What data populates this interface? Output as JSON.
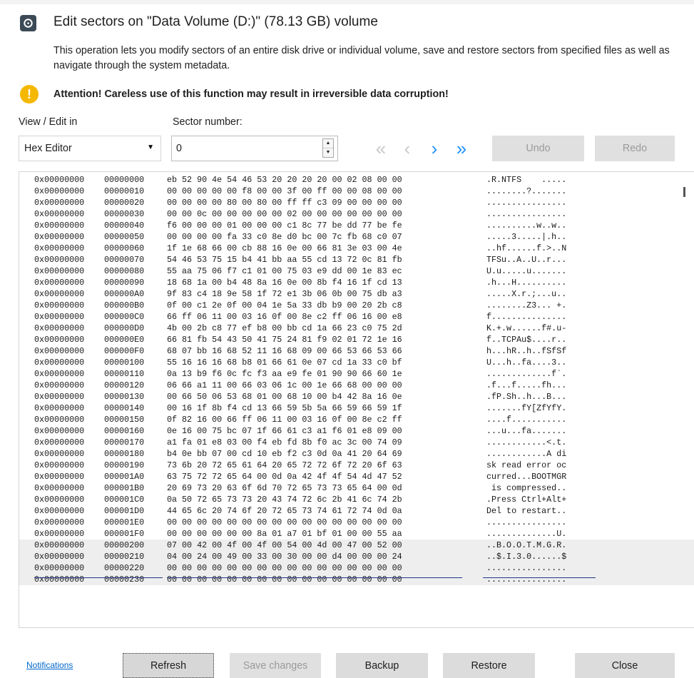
{
  "dialog": {
    "title": "Edit sectors on \"Data Volume (D:)\" (78.13 GB) volume",
    "description": "This operation lets you modify sectors of an entire disk drive or individual volume, save and restore sectors from specified files as well as navigate through the system metadata.",
    "warning": "Attention! Careless use of this function may result in irreversible data corruption!",
    "warning_icon": "exclamation-icon",
    "app_icon": "disk-icon"
  },
  "toolbar": {
    "view_label": "View / Edit in",
    "view_value": "Hex Editor",
    "sector_label": "Sector number:",
    "sector_value": "0",
    "first_glyph": "«",
    "prev_glyph": "‹",
    "next_glyph": "›",
    "last_glyph": "»",
    "undo_label": "Undo",
    "redo_label": "Redo"
  },
  "hex": {
    "rows": [
      {
        "addr": "0x00000000",
        "off": "00000000",
        "hex": "eb 52 90 4e 54 46 53 20 20 20 20 00 02 08 00 00",
        "ascii": ".R.NTFS    ....."
      },
      {
        "addr": "0x00000000",
        "off": "00000010",
        "hex": "00 00 00 00 00 f8 00 00 3f 00 ff 00 00 08 00 00",
        "ascii": "........?......."
      },
      {
        "addr": "0x00000000",
        "off": "00000020",
        "hex": "00 00 00 00 80 00 80 00 ff ff c3 09 00 00 00 00",
        "ascii": "................"
      },
      {
        "addr": "0x00000000",
        "off": "00000030",
        "hex": "00 00 0c 00 00 00 00 00 02 00 00 00 00 00 00 00",
        "ascii": "................"
      },
      {
        "addr": "0x00000000",
        "off": "00000040",
        "hex": "f6 00 00 00 01 00 00 00 c1 8c 77 be dd 77 be fe",
        "ascii": "..........w..w.."
      },
      {
        "addr": "0x00000000",
        "off": "00000050",
        "hex": "00 00 00 00 fa 33 c0 8e d0 bc 00 7c fb 68 c0 07",
        "ascii": ".....3.....|.h.."
      },
      {
        "addr": "0x00000000",
        "off": "00000060",
        "hex": "1f 1e 68 66 00 cb 88 16 0e 00 66 81 3e 03 00 4e",
        "ascii": "..hf......f.>..N"
      },
      {
        "addr": "0x00000000",
        "off": "00000070",
        "hex": "54 46 53 75 15 b4 41 bb aa 55 cd 13 72 0c 81 fb",
        "ascii": "TFSu..A..U..r..."
      },
      {
        "addr": "0x00000000",
        "off": "00000080",
        "hex": "55 aa 75 06 f7 c1 01 00 75 03 e9 dd 00 1e 83 ec",
        "ascii": "U.u.....u......."
      },
      {
        "addr": "0x00000000",
        "off": "00000090",
        "hex": "18 68 1a 00 b4 48 8a 16 0e 00 8b f4 16 1f cd 13",
        "ascii": ".h...H.........."
      },
      {
        "addr": "0x00000000",
        "off": "000000A0",
        "hex": "9f 83 c4 18 9e 58 1f 72 e1 3b 06 0b 00 75 db a3",
        "ascii": ".....X.r.;...u.."
      },
      {
        "addr": "0x00000000",
        "off": "000000B0",
        "hex": "0f 00 c1 2e 0f 00 04 1e 5a 33 db b9 00 20 2b c8",
        "ascii": "........Z3... +."
      },
      {
        "addr": "0x00000000",
        "off": "000000C0",
        "hex": "66 ff 06 11 00 03 16 0f 00 8e c2 ff 06 16 00 e8",
        "ascii": "f..............."
      },
      {
        "addr": "0x00000000",
        "off": "000000D0",
        "hex": "4b 00 2b c8 77 ef b8 00 bb cd 1a 66 23 c0 75 2d",
        "ascii": "K.+.w......f#.u-"
      },
      {
        "addr": "0x00000000",
        "off": "000000E0",
        "hex": "66 81 fb 54 43 50 41 75 24 81 f9 02 01 72 1e 16",
        "ascii": "f..TCPAu$....r.."
      },
      {
        "addr": "0x00000000",
        "off": "000000F0",
        "hex": "68 07 bb 16 68 52 11 16 68 09 00 66 53 66 53 66",
        "ascii": "h...hR..h..fSfSf"
      },
      {
        "addr": "0x00000000",
        "off": "00000100",
        "hex": "55 16 16 16 68 b8 01 66 61 0e 07 cd 1a 33 c0 bf",
        "ascii": "U...h..fa....3.."
      },
      {
        "addr": "0x00000000",
        "off": "00000110",
        "hex": "0a 13 b9 f6 0c fc f3 aa e9 fe 01 90 90 66 60 1e",
        "ascii": ".............f`."
      },
      {
        "addr": "0x00000000",
        "off": "00000120",
        "hex": "06 66 a1 11 00 66 03 06 1c 00 1e 66 68 00 00 00",
        "ascii": ".f...f.....fh..."
      },
      {
        "addr": "0x00000000",
        "off": "00000130",
        "hex": "00 66 50 06 53 68 01 00 68 10 00 b4 42 8a 16 0e",
        "ascii": ".fP.Sh..h...B..."
      },
      {
        "addr": "0x00000000",
        "off": "00000140",
        "hex": "00 16 1f 8b f4 cd 13 66 59 5b 5a 66 59 66 59 1f",
        "ascii": ".......fY[ZfYfY."
      },
      {
        "addr": "0x00000000",
        "off": "00000150",
        "hex": "0f 82 16 00 66 ff 06 11 00 03 16 0f 00 8e c2 ff",
        "ascii": "....f..........."
      },
      {
        "addr": "0x00000000",
        "off": "00000160",
        "hex": "0e 16 00 75 bc 07 1f 66 61 c3 a1 f6 01 e8 09 00",
        "ascii": "...u...fa......."
      },
      {
        "addr": "0x00000000",
        "off": "00000170",
        "hex": "a1 fa 01 e8 03 00 f4 eb fd 8b f0 ac 3c 00 74 09",
        "ascii": "............<.t."
      },
      {
        "addr": "0x00000000",
        "off": "00000180",
        "hex": "b4 0e bb 07 00 cd 10 eb f2 c3 0d 0a 41 20 64 69",
        "ascii": "............A di"
      },
      {
        "addr": "0x00000000",
        "off": "00000190",
        "hex": "73 6b 20 72 65 61 64 20 65 72 72 6f 72 20 6f 63",
        "ascii": "sk read error oc"
      },
      {
        "addr": "0x00000000",
        "off": "000001A0",
        "hex": "63 75 72 72 65 64 00 0d 0a 42 4f 4f 54 4d 47 52",
        "ascii": "curred...BOOTMGR"
      },
      {
        "addr": "0x00000000",
        "off": "000001B0",
        "hex": "20 69 73 20 63 6f 6d 70 72 65 73 73 65 64 00 0d",
        "ascii": " is compressed.."
      },
      {
        "addr": "0x00000000",
        "off": "000001C0",
        "hex": "0a 50 72 65 73 73 20 43 74 72 6c 2b 41 6c 74 2b",
        "ascii": ".Press Ctrl+Alt+"
      },
      {
        "addr": "0x00000000",
        "off": "000001D0",
        "hex": "44 65 6c 20 74 6f 20 72 65 73 74 61 72 74 0d 0a",
        "ascii": "Del to restart.."
      },
      {
        "addr": "0x00000000",
        "off": "000001E0",
        "hex": "00 00 00 00 00 00 00 00 00 00 00 00 00 00 00 00",
        "ascii": "................"
      },
      {
        "addr": "0x00000000",
        "off": "000001F0",
        "hex": "00 00 00 00 00 00 8a 01 a7 01 bf 01 00 00 55 aa",
        "ascii": "..............U."
      },
      {
        "addr": "0x00000000",
        "off": "00000200",
        "hex": "07 00 42 00 4f 00 4f 00 54 00 4d 00 47 00 52 00",
        "ascii": "..B.O.O.T.M.G.R."
      },
      {
        "addr": "0x00000000",
        "off": "00000210",
        "hex": "04 00 24 00 49 00 33 00 30 00 00 d4 00 00 00 24",
        "ascii": "..$.I.3.0......$"
      },
      {
        "addr": "0x00000000",
        "off": "00000220",
        "hex": "00 00 00 00 00 00 00 00 00 00 00 00 00 00 00 00",
        "ascii": "................"
      },
      {
        "addr": "0x00000000",
        "off": "00000230",
        "hex": "00 00 00 00 00 00 00 00 00 00 00 00 00 00 00 00",
        "ascii": "................"
      }
    ]
  },
  "footer": {
    "notifications_label": "Notifications",
    "refresh_label": "Refresh",
    "save_label": "Save changes",
    "backup_label": "Backup",
    "restore_label": "Restore",
    "close_label": "Close"
  },
  "colors": {
    "accent": "#1e90ff",
    "nav_disabled": "#c8c8c8",
    "warning": "#f5b800",
    "separator": "#1e3a8a"
  }
}
